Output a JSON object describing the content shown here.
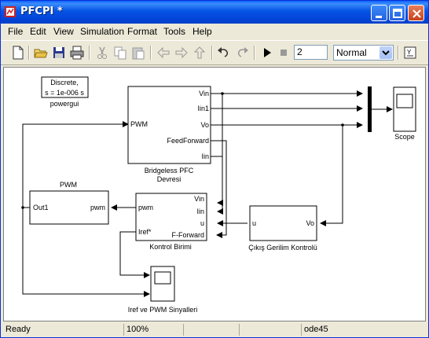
{
  "window": {
    "title": "PFCPI *"
  },
  "menu": [
    "File",
    "Edit",
    "View",
    "Simulation",
    "Format",
    "Tools",
    "Help"
  ],
  "toolbar": {
    "stop_time": "2",
    "sim_mode": "Normal"
  },
  "canvas": {
    "powergui": {
      "line1": "Discrete,",
      "line2": "s = 1e-006 s",
      "label": "powergui"
    },
    "pfc": {
      "ports": [
        "Vin",
        "Iin1",
        "Vo",
        "FeedForward",
        "Iin"
      ],
      "in_port": "PWM",
      "label1": "Bridgeless PFC",
      "label2": "Devresi"
    },
    "pwm": {
      "title": "PWM",
      "in_port": "Out1",
      "out_port": "pwm"
    },
    "kontrol": {
      "in_ports": [
        "pwm",
        "Iref*"
      ],
      "out_ports": [
        "Vin",
        "Iin",
        "u",
        "F-Forward"
      ],
      "label": "Kontrol Birimi"
    },
    "cikis": {
      "in_port": "u",
      "out_port": "Vo",
      "label": "Çıkış Gerilim Kontrolü"
    },
    "scope": {
      "label": "Scope"
    },
    "scope2": {
      "label": "Iref ve PWM Sinyalleri"
    }
  },
  "status": {
    "state": "Ready",
    "zoom": "100%",
    "solver": "ode45"
  }
}
